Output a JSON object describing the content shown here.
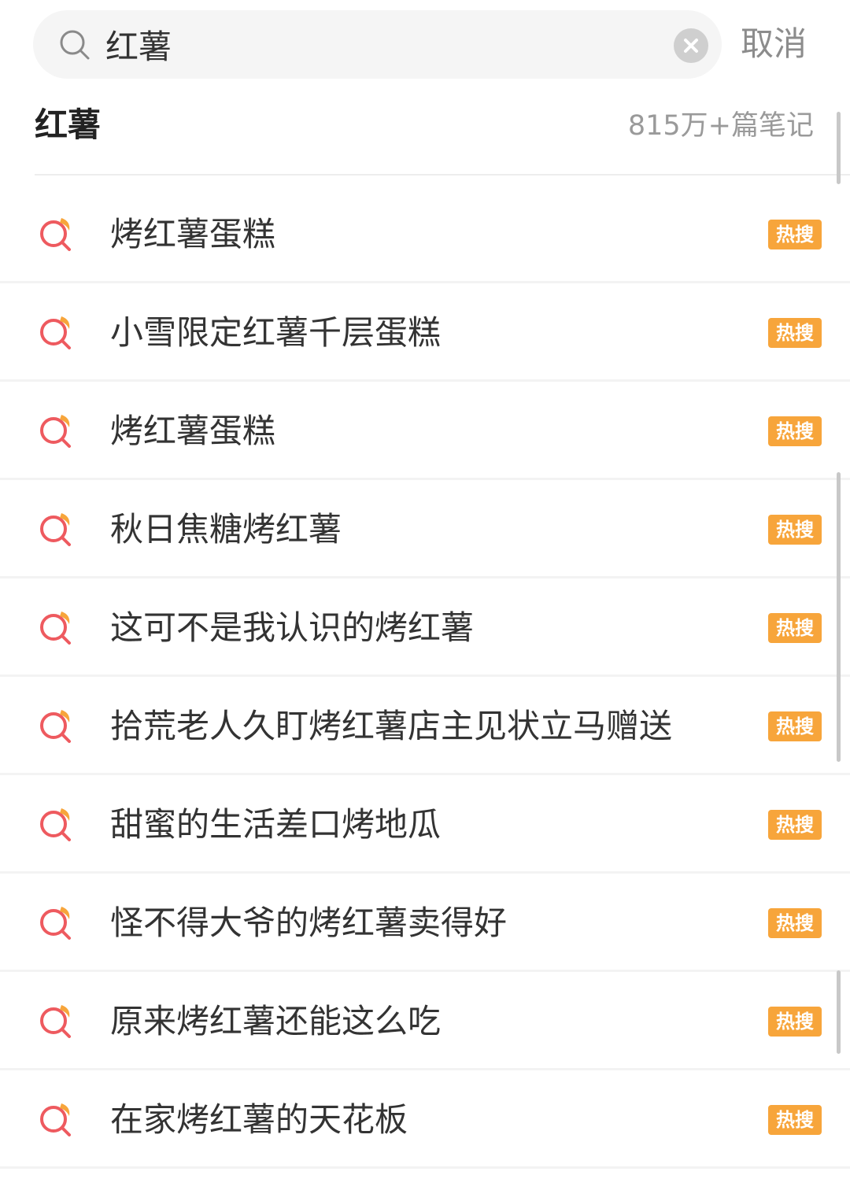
{
  "search": {
    "value": "红薯",
    "cancel_label": "取消"
  },
  "top_suggestion": {
    "term": "红薯",
    "count": "815万+篇笔记"
  },
  "suggestions": [
    {
      "label": "烤红薯蛋糕",
      "badge": "热搜"
    },
    {
      "label": "小雪限定红薯千层蛋糕",
      "badge": "热搜"
    },
    {
      "label": "烤红薯蛋糕",
      "badge": "热搜"
    },
    {
      "label": "秋日焦糖烤红薯",
      "badge": "热搜"
    },
    {
      "label": "这可不是我认识的烤红薯",
      "badge": "热搜"
    },
    {
      "label": "拾荒老人久盯烤红薯店主见状立马赠送",
      "badge": "热搜"
    },
    {
      "label": "甜蜜的生活差口烤地瓜",
      "badge": "热搜"
    },
    {
      "label": "怪不得大爷的烤红薯卖得好",
      "badge": "热搜"
    },
    {
      "label": "原来烤红薯还能这么吃",
      "badge": "热搜"
    },
    {
      "label": "在家烤红薯的天花板",
      "badge": "热搜"
    }
  ],
  "icons": {
    "search": "search-icon",
    "clear": "clear-icon",
    "suggestion": "search-suggestion-icon"
  },
  "colors": {
    "accent_red": "#ee5a5f",
    "accent_orange": "#f7a53b",
    "badge_bg": "#f7a53b",
    "search_bg": "#f5f5f5",
    "muted_text": "#9a9a9a"
  }
}
